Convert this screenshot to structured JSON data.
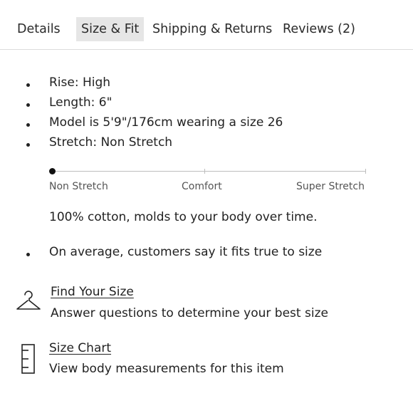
{
  "tabs": [
    {
      "label": "Details",
      "active": false
    },
    {
      "label": "Size & Fit",
      "active": true
    },
    {
      "label": "Shipping & Returns",
      "active": false
    },
    {
      "label": "Reviews (2)",
      "active": false
    }
  ],
  "fit_details": [
    "Rise: High",
    "Length: 6\"",
    "Model is 5'9\"/176cm wearing a size 26",
    "Stretch: Non Stretch"
  ],
  "stretch_scale": {
    "labels": [
      "Non Stretch",
      "Comfort",
      "Super Stretch"
    ],
    "selected": "Non Stretch"
  },
  "fabric_note": "100% cotton, molds to your body over time.",
  "fit_summary": "On average, customers say it fits true to size",
  "find_size": {
    "icon": "hanger-icon",
    "title": "Find Your Size",
    "subtitle": "Answer questions to determine your best size"
  },
  "size_chart": {
    "icon": "ruler-icon",
    "title": "Size Chart",
    "subtitle": "View body measurements for this item"
  }
}
